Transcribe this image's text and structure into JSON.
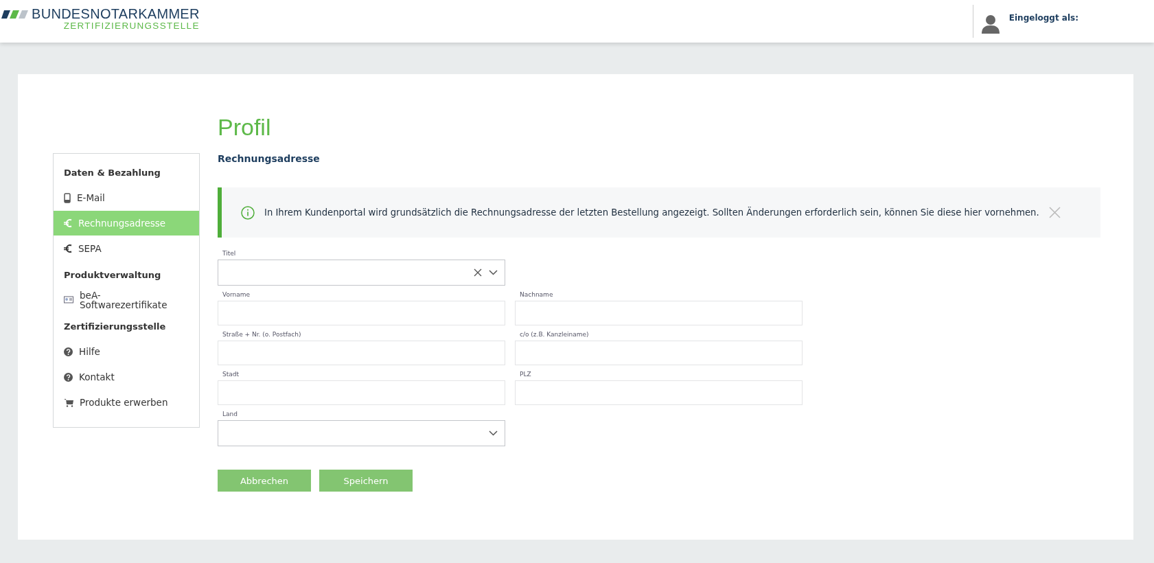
{
  "header": {
    "logo": {
      "name": "BUNDESNOTARKAMMER",
      "subtitle": "ZERTIFIZIERUNGSSTELLE"
    },
    "user_label": "Eingeloggt als:"
  },
  "sidebar": {
    "items": [
      {
        "kind": "heading",
        "label": "Daten & Bezahlung"
      },
      {
        "kind": "link",
        "label": "E-Mail",
        "selected": false
      },
      {
        "kind": "link",
        "label": "Rechnungsadresse",
        "selected": true
      },
      {
        "kind": "link",
        "label": "SEPA",
        "selected": false
      },
      {
        "kind": "heading",
        "label": "Produktverwaltung"
      },
      {
        "kind": "link",
        "label": "beA-Softwarezertifikate",
        "selected": false
      },
      {
        "kind": "heading",
        "label": "Zertifizierungsstelle"
      },
      {
        "kind": "link",
        "label": "Hilfe",
        "selected": false
      },
      {
        "kind": "link",
        "label": "Kontakt",
        "selected": false
      },
      {
        "kind": "link",
        "label": "Produkte erwerben",
        "selected": false
      }
    ]
  },
  "page": {
    "title": "Profil",
    "section_title": "Rechnungsadresse",
    "notice": {
      "text": "In Ihrem Kundenportal wird grundsätzlich die Rechnungsadresse der letzten Bestellung angezeigt. Sollten Änderungen erforderlich sein, können Sie diese hier vornehmen."
    },
    "fields": [
      {
        "kind": "select",
        "label": "Titel",
        "clearable": true
      },
      {
        "kind": "break"
      },
      {
        "kind": "text",
        "label": "Vorname"
      },
      {
        "kind": "text",
        "label": "Nachname"
      },
      {
        "kind": "text",
        "label": "Straße + Nr. (o. Postfach)"
      },
      {
        "kind": "text",
        "label": "c/o (z.B. Kanzleiname)"
      },
      {
        "kind": "text",
        "label": "Stadt"
      },
      {
        "kind": "text",
        "label": "PLZ"
      },
      {
        "kind": "select",
        "label": "Land",
        "clearable": false
      }
    ],
    "buttons": [
      "Abbrechen",
      "Speichern"
    ]
  }
}
